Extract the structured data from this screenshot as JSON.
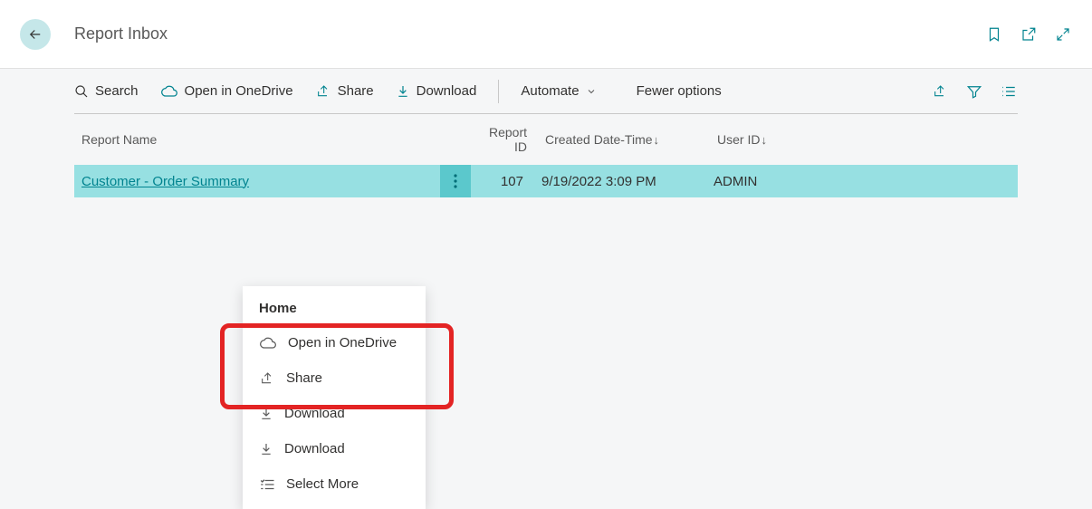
{
  "header": {
    "title": "Report Inbox"
  },
  "toolbar": {
    "search": "Search",
    "open_onedrive": "Open in OneDrive",
    "share": "Share",
    "download": "Download",
    "automate": "Automate",
    "fewer_options": "Fewer options"
  },
  "table": {
    "columns": {
      "report_name": "Report Name",
      "report_id": "Report ID",
      "created": "Created Date-Time",
      "user_id": "User ID"
    },
    "rows": [
      {
        "name": "Customer - Order Summary",
        "id": "107",
        "created": "9/19/2022 3:09 PM",
        "user": "ADMIN"
      }
    ]
  },
  "context_menu": {
    "title": "Home",
    "items": [
      {
        "label": "Open in OneDrive"
      },
      {
        "label": "Share"
      },
      {
        "label": "Download"
      },
      {
        "label": "Download"
      },
      {
        "label": "Select More"
      }
    ]
  }
}
